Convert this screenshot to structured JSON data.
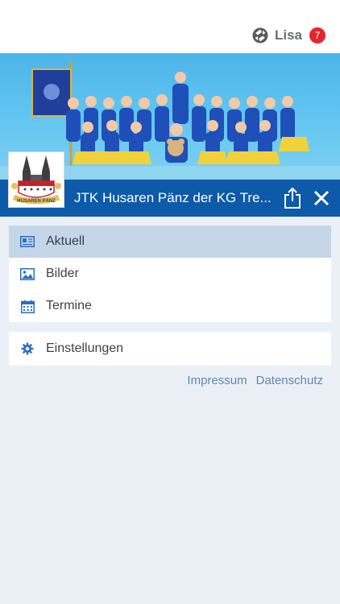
{
  "header": {
    "user_icon": "team-logo-icon",
    "username": "Lisa",
    "notification_count": "7"
  },
  "club": {
    "banner": "group-photo",
    "logo": "husaren-paenz-logo",
    "logo_text": "HUSAREN PÄNZ",
    "name": "JTK Husaren Pänz der KG Tre...",
    "share_icon": "share-icon",
    "close_icon": "close-icon"
  },
  "menu": {
    "items": [
      {
        "label": "Aktuell",
        "icon": "newspaper-icon",
        "active": true
      },
      {
        "label": "Bilder",
        "icon": "image-icon",
        "active": false
      },
      {
        "label": "Termine",
        "icon": "calendar-icon",
        "active": false
      }
    ],
    "settings": {
      "label": "Einstellungen",
      "icon": "gear-icon"
    }
  },
  "footer_links": {
    "impressum": "Impressum",
    "datenschutz": "Datenschutz"
  },
  "colors": {
    "primary": "#0d5aa8",
    "active_item": "#c5d6e9",
    "badge": "#e3262d",
    "background": "#ebf0f7",
    "link": "#5e87ae"
  }
}
